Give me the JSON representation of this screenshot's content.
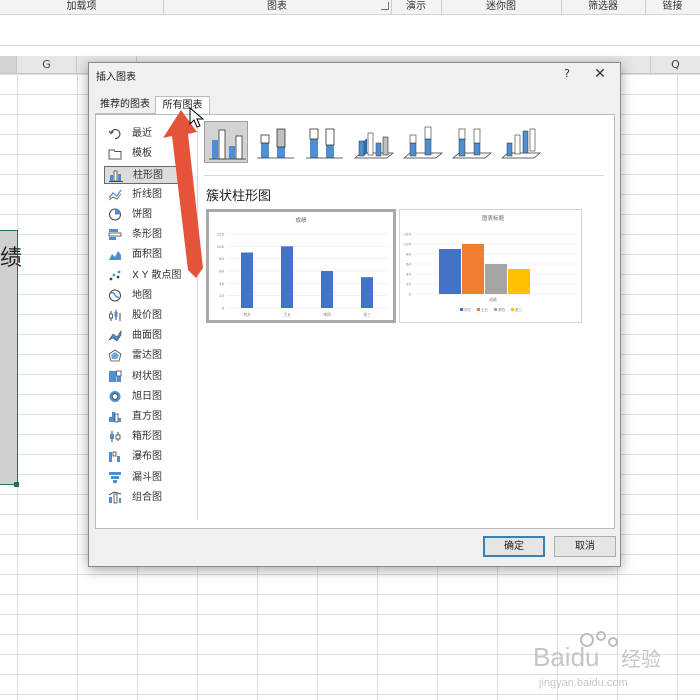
{
  "ribbon": {
    "groups": [
      "加载项",
      "图表",
      "演示",
      "迷你图",
      "筛选器",
      "链接"
    ]
  },
  "columns": [
    "G",
    "",
    "",
    "",
    "",
    "",
    "",
    "",
    "",
    "",
    "Q"
  ],
  "sheet": {
    "selected_cell_text": "绩"
  },
  "dialog": {
    "title": "插入图表",
    "help": "?",
    "close": "✕",
    "tabs": {
      "recommended": "推荐的图表",
      "all": "所有图表"
    },
    "chart_types": [
      {
        "label": "最近",
        "icon": "recent-icon"
      },
      {
        "label": "模板",
        "icon": "template-folder-icon"
      },
      {
        "label": "柱形图",
        "icon": "column-chart-icon",
        "selected": true
      },
      {
        "label": "折线图",
        "icon": "line-chart-icon"
      },
      {
        "label": "饼图",
        "icon": "pie-chart-icon"
      },
      {
        "label": "条形图",
        "icon": "bar-chart-icon"
      },
      {
        "label": "面积图",
        "icon": "area-chart-icon"
      },
      {
        "label": "X Y 散点图",
        "icon": "scatter-chart-icon"
      },
      {
        "label": "地图",
        "icon": "map-chart-icon"
      },
      {
        "label": "股价图",
        "icon": "stock-chart-icon"
      },
      {
        "label": "曲面图",
        "icon": "surface-chart-icon"
      },
      {
        "label": "雷达图",
        "icon": "radar-chart-icon"
      },
      {
        "label": "树状图",
        "icon": "treemap-chart-icon"
      },
      {
        "label": "旭日图",
        "icon": "sunburst-chart-icon"
      },
      {
        "label": "直方图",
        "icon": "histogram-chart-icon"
      },
      {
        "label": "箱形图",
        "icon": "box-whisker-chart-icon"
      },
      {
        "label": "瀑布图",
        "icon": "waterfall-chart-icon"
      },
      {
        "label": "漏斗图",
        "icon": "funnel-chart-icon"
      },
      {
        "label": "组合图",
        "icon": "combo-chart-icon"
      }
    ],
    "section_title": "簇状柱形图",
    "buttons": {
      "ok": "确定",
      "cancel": "取消"
    }
  },
  "colors": {
    "accent_blue": "#4472C4",
    "orange": "#ED7D31",
    "gray": "#A5A5A5",
    "gold": "#FFC000",
    "arrow_red": "#E5533A",
    "excel_green": "#217346"
  },
  "chart_data": [
    {
      "type": "bar",
      "title": "成绩",
      "categories": [
        "刘方",
        "王五",
        "李四",
        "张三"
      ],
      "values": [
        90,
        100,
        60,
        50
      ],
      "ylim": [
        0,
        120
      ],
      "yticks": [
        "120",
        "100",
        "80",
        "60",
        "40",
        "20",
        "0"
      ],
      "grid": true
    },
    {
      "type": "bar",
      "title": "图表标题",
      "categories": [
        "成绩"
      ],
      "series": [
        {
          "name": "刘方",
          "values": [
            90
          ]
        },
        {
          "name": "王五",
          "values": [
            100
          ]
        },
        {
          "name": "李四",
          "values": [
            60
          ]
        },
        {
          "name": "张三",
          "values": [
            50
          ]
        }
      ],
      "ylim": [
        0,
        120
      ],
      "yticks": [
        "120",
        "100",
        "80",
        "60",
        "40",
        "20",
        "0"
      ],
      "grid": true,
      "legend": "bottom"
    }
  ],
  "watermark": {
    "brand": "Baidu",
    "cn": "经验",
    "url": "jingyan.baidu.com"
  }
}
